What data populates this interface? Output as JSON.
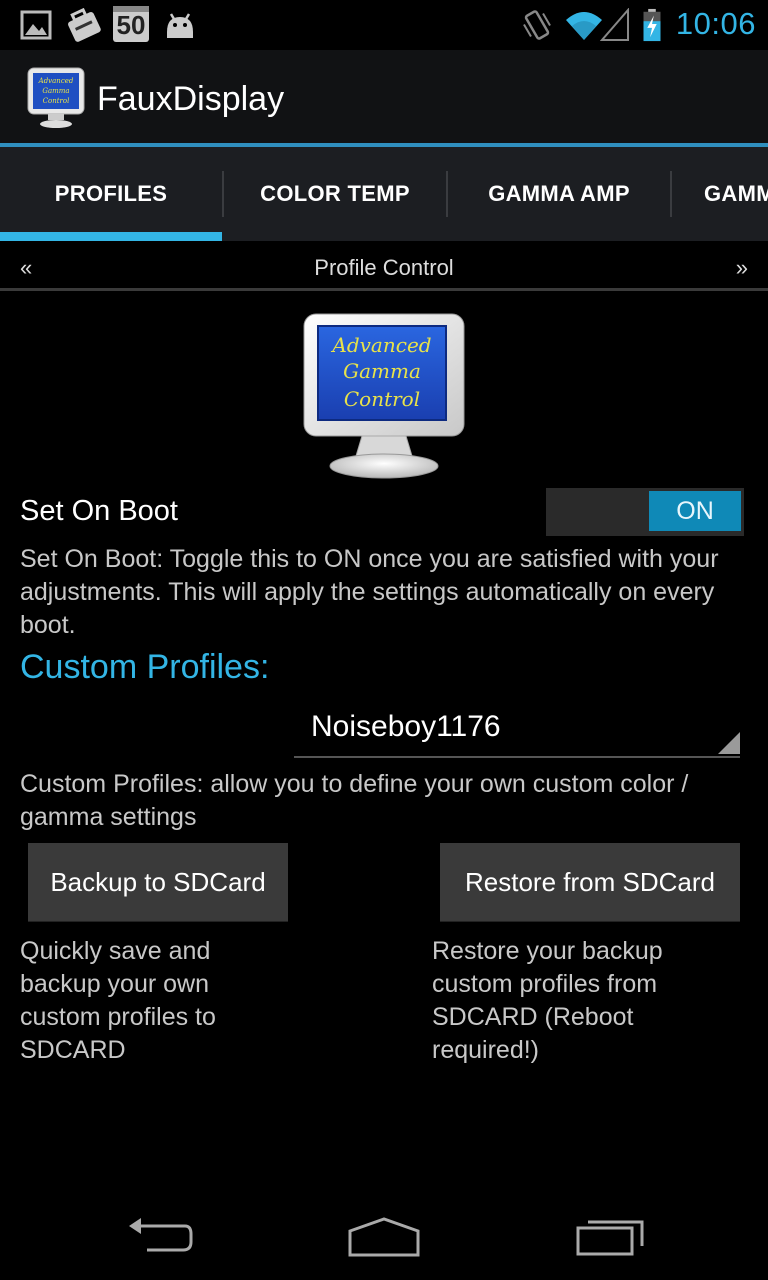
{
  "status_bar": {
    "time": "10:06",
    "notification_badge": "50",
    "icons": [
      "gallery-icon",
      "hardware-toolbox-icon",
      "calendar-50-icon",
      "android-debug-icon",
      "vibrate-icon",
      "wifi-icon",
      "signal-icon",
      "battery-charging-icon"
    ]
  },
  "action_bar": {
    "title": "FauxDisplay",
    "app_icon_text": [
      "Advanced",
      "Gamma",
      "Control"
    ]
  },
  "tabs": [
    {
      "label": "PROFILES",
      "selected": true
    },
    {
      "label": "COLOR TEMP",
      "selected": false
    },
    {
      "label": "GAMMA AMP",
      "selected": false
    },
    {
      "label": "GAMM",
      "selected": false
    }
  ],
  "pager": {
    "title": "Profile Control",
    "prev": "«",
    "next": "»"
  },
  "logo_text": [
    "Advanced",
    "Gamma",
    "Control"
  ],
  "set_on_boot": {
    "label": "Set On Boot",
    "toggle_state": "ON",
    "description": "Set On Boot: Toggle this to ON once you are satisfied with your adjustments. This will apply the settings automatically on every boot."
  },
  "custom_profiles": {
    "heading": "Custom Profiles:",
    "selected_profile": "Noiseboy1176",
    "description": "Custom Profiles: allow you to define your own custom color / gamma settings"
  },
  "backup": {
    "button_label": "Backup to SDCard",
    "description": "Quickly save and backup your own custom profiles to SDCARD"
  },
  "restore": {
    "button_label": "Restore from SDCard",
    "description": "Restore your backup custom profiles from SDCARD (Reboot required!)"
  },
  "nav_bar": {
    "icons": [
      "back-icon",
      "home-icon",
      "recent-apps-icon"
    ]
  },
  "colors": {
    "accent": "#33b5e5",
    "toggle_on": "#0f89b7",
    "background": "#000000",
    "tab_bar": "#1c1e22"
  }
}
